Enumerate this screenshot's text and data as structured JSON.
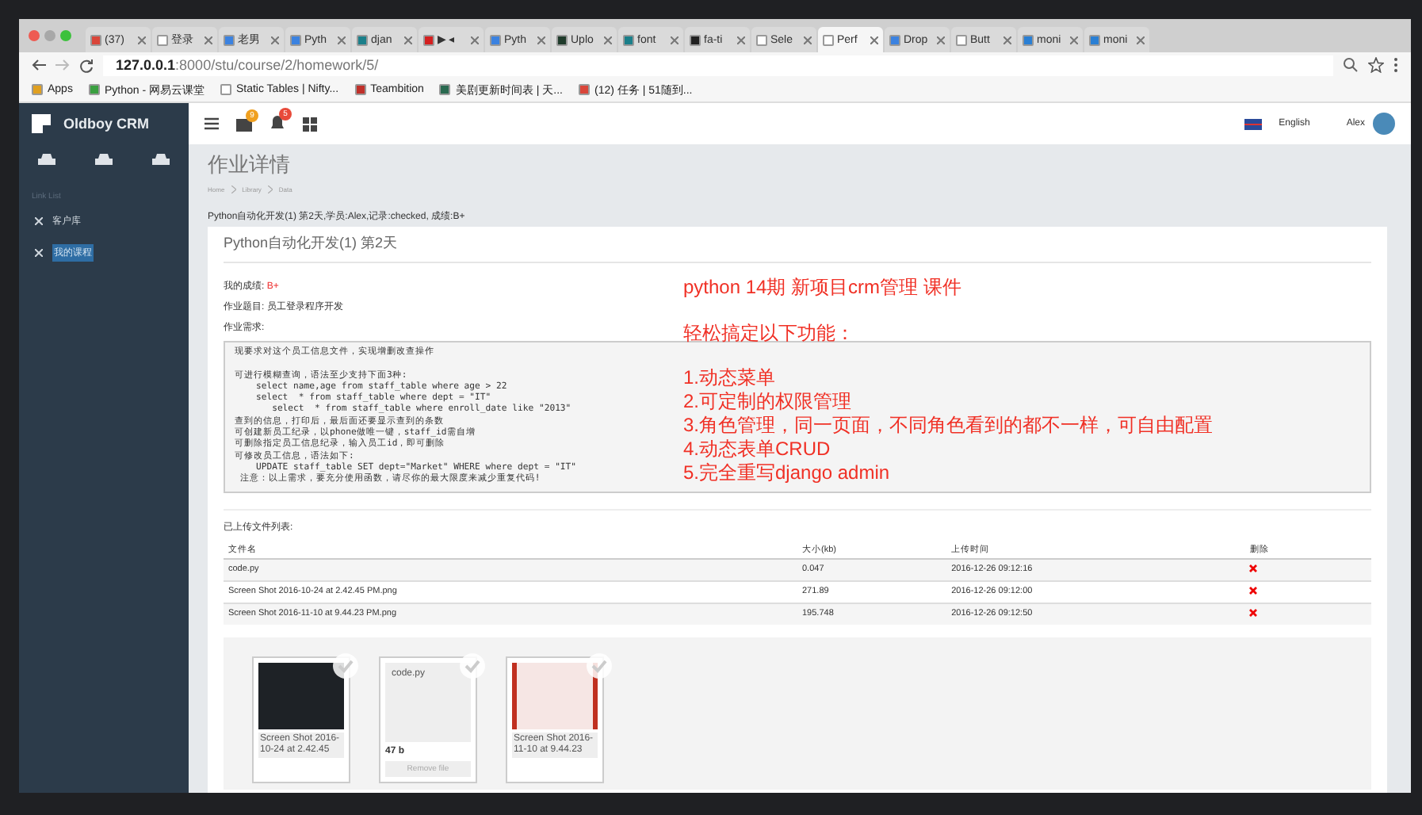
{
  "browser": {
    "tabs": [
      {
        "label": "(37)",
        "selected": false,
        "color": "#d9463a"
      },
      {
        "label": "登录",
        "selected": false,
        "color": "#ffffff"
      },
      {
        "label": "老男",
        "selected": false,
        "color": "#3b82e0"
      },
      {
        "label": "Pyth",
        "selected": false,
        "color": "#3b82e0"
      },
      {
        "label": "djan",
        "selected": false,
        "color": "#1b7f8a"
      },
      {
        "label": "▶ ◂",
        "selected": false,
        "color": "#d42020"
      },
      {
        "label": "Pyth",
        "selected": false,
        "color": "#3b82e0"
      },
      {
        "label": "Uplo",
        "selected": false,
        "color": "#1f3b2b"
      },
      {
        "label": "font",
        "selected": false,
        "color": "#1b7f8a"
      },
      {
        "label": "fa-ti",
        "selected": false,
        "color": "#222222"
      },
      {
        "label": "Sele",
        "selected": false,
        "color": "#ffffff"
      },
      {
        "label": "Perf",
        "selected": true,
        "color": "#ffffff"
      },
      {
        "label": "Drop",
        "selected": false,
        "color": "#3b82e0"
      },
      {
        "label": "Butt",
        "selected": false,
        "color": "#ffffff"
      },
      {
        "label": "moni",
        "selected": false,
        "color": "#2a7fd4"
      },
      {
        "label": "moni",
        "selected": false,
        "color": "#2a7fd4"
      }
    ],
    "url_host": "127.0.0.1",
    "url_rest": ":8000/stu/course/2/homework/5/",
    "bookmarks": [
      {
        "label": "Apps",
        "color": "#e0a020"
      },
      {
        "label": "Python - 网易云课堂",
        "color": "#3aa040"
      },
      {
        "label": "Static Tables | Nifty...",
        "color": "#ffffff"
      },
      {
        "label": "Teambition",
        "color": "#c0302a"
      },
      {
        "label": "美剧更新时间表 | 天...",
        "color": "#2a6a50"
      },
      {
        "label": "(12) 任务 | 51随到...",
        "color": "#d9463a"
      }
    ]
  },
  "sidebar": {
    "brand": "Oldboy CRM",
    "section": "Link List",
    "items": [
      {
        "label": "客户库",
        "selected": false
      },
      {
        "label": "我的课程",
        "selected": true
      }
    ]
  },
  "topbar": {
    "badges": [
      "9",
      "5"
    ],
    "language": "English",
    "user": "Alex"
  },
  "page": {
    "title": "作业详情",
    "breadcrumb": [
      "Home",
      "Library",
      "Data"
    ],
    "summary": "Python自动化开发(1) 第2天,学员:Alex,记录:checked, 成绩:B+",
    "card_title": "Python自动化开发(1) 第2天",
    "grade_label": "我的成绩:",
    "grade": "B+",
    "topic_label": "作业题目:",
    "topic": "员工登录程序开发",
    "req_label": "作业需求:",
    "requirements": [
      [
        "现要求对这个员工信息文件，实现增删改查操作"
      ],
      [
        "可进行模糊查询，语法至少支持下面3种:",
        "    select name,age from staff_table where age > 22",
        "    select  * from staff_table where dept = \"IT\"",
        "       select  * from staff_table where enroll_date like \"2013\"",
        "查到的信息，打印后，最后面还要显示查到的条数",
        "可创建新员工纪录，以phone做唯一键，staff_id需自增",
        "可删除指定员工信息纪录，输入员工id，即可删除",
        "可修改员工信息，语法如下:",
        "    UPDATE staff_table SET dept=\"Market\" WHERE where dept = \"IT\"",
        " 注意：以上需求，要充分使用函数，请尽你的最大限度来减少重复代码!"
      ]
    ],
    "overlay": {
      "heading": "python 14期   新项目crm管理 课件",
      "subheading": "轻松搞定以下功能：",
      "items": [
        "1.动态菜单",
        "2.可定制的权限管理",
        "3.角色管理，同一页面，不同角色看到的都不一样，可自由配置",
        "4.动态表单CRUD",
        "5.完全重写django admin"
      ]
    },
    "files_label": "已上传文件列表:",
    "table": {
      "columns": [
        "文件名",
        "大小(kb)",
        "上传时间",
        "删除"
      ],
      "rows": [
        [
          "code.py",
          "0.047",
          "2016-12-26 09:12:16"
        ],
        [
          "Screen Shot 2016-10-24 at 2.42.45 PM.png",
          "271.89",
          "2016-12-26 09:12:00"
        ],
        [
          "Screen Shot 2016-11-10 at 9.44.23 PM.png",
          "195.748",
          "2016-12-26 09:12:50"
        ]
      ]
    },
    "previews": [
      {
        "kind": "image",
        "caption": "Screen Shot 2016-10-24 at 2.42.45"
      },
      {
        "kind": "file",
        "name": "code.py",
        "size": "47 b",
        "action": "Remove file"
      },
      {
        "kind": "image",
        "caption": "Screen Shot 2016-11-10 at 9.44.23"
      }
    ]
  }
}
